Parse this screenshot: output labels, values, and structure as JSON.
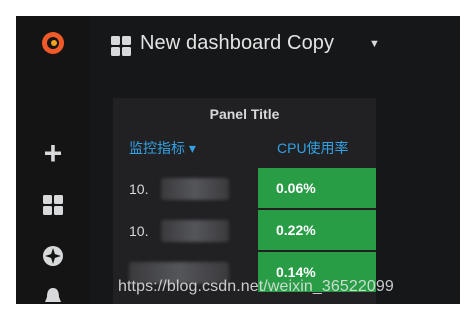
{
  "dashboard": {
    "title": "New dashboard Copy"
  },
  "panel": {
    "title": "Panel Title",
    "columns": {
      "metric": "监控指标 ▾",
      "cpu": "CPU使用率"
    },
    "rows": [
      {
        "ip": "10.",
        "cpu": "0.06%"
      },
      {
        "ip": "10.",
        "cpu": "0.22%"
      },
      {
        "ip": "",
        "cpu": "0.14%"
      }
    ]
  },
  "watermark": "https://blog.csdn.net/weixin_36522099",
  "colors": {
    "cell_green": "#299c46",
    "header_blue": "#33a2e5",
    "logo_orange": "#f05a28"
  }
}
